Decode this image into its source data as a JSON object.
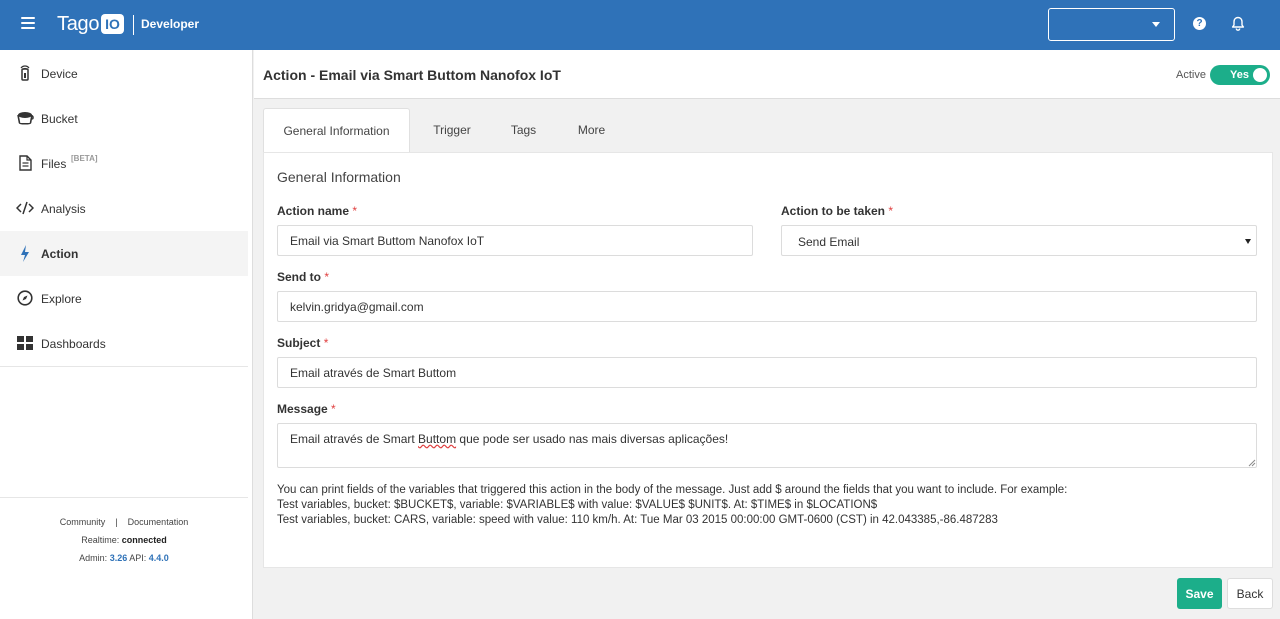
{
  "topbar": {
    "menu_icon": "hamburger-icon",
    "logo_text": "Tago",
    "logo_badge": "IO",
    "environment": "Developer",
    "select_value": "",
    "help_icon": "question-icon",
    "help_glyph": "?",
    "bell_icon": "bell-icon",
    "brand_color": "#2f72b8"
  },
  "sidebar": {
    "items": [
      {
        "label": "Device",
        "icon": "device-icon"
      },
      {
        "label": "Bucket",
        "icon": "bucket-icon"
      },
      {
        "label": "Files",
        "icon": "file-icon",
        "badge": "[BETA]"
      },
      {
        "label": "Analysis",
        "icon": "code-icon"
      },
      {
        "label": "Action",
        "icon": "bolt-icon",
        "active": true
      },
      {
        "label": "Explore",
        "icon": "compass-icon"
      },
      {
        "label": "Dashboards",
        "icon": "grid-icon"
      }
    ],
    "footer": {
      "community": "Community",
      "separator": "|",
      "documentation": "Documentation",
      "realtime_label": "Realtime:",
      "realtime_value": "connected",
      "admin_label": "Admin:",
      "admin_version": "3.26",
      "api_label": "API:",
      "api_version": "4.4.0"
    }
  },
  "header": {
    "title": "Action - Email via Smart Buttom Nanofox IoT",
    "active_label": "Active",
    "toggle_text": "Yes",
    "toggle_on": true,
    "accent_color": "#1cae8a"
  },
  "tabs": [
    {
      "label": "General Information",
      "active": true
    },
    {
      "label": "Trigger"
    },
    {
      "label": "Tags"
    },
    {
      "label": "More"
    }
  ],
  "form": {
    "section_title": "General Information",
    "required_mark": "*",
    "action_name": {
      "label": "Action name",
      "value": "Email via Smart Buttom Nanofox IoT"
    },
    "action_taken": {
      "label": "Action to be taken",
      "value": "Send Email"
    },
    "send_to": {
      "label": "Send to",
      "value": "kelvin.gridya@gmail.com"
    },
    "subject": {
      "label": "Subject",
      "value": "Email através de Smart Buttom"
    },
    "message": {
      "label": "Message",
      "value": "Email através de Smart Buttom que pode ser usado nas mais diversas aplicações!",
      "part1": "Email através de Smart ",
      "part2": "Buttom",
      "part3": " que pode ser usado nas mais diversas aplicações!"
    },
    "help_lines": [
      "You can print fields of the variables that triggered this action in the body of the message. Just add $ around the fields that you want to include. For example:",
      "Test variables, bucket: $BUCKET$, variable: $VARIABLE$ with value: $VALUE$ $UNIT$. At: $TIME$ in $LOCATION$",
      "Test variables, bucket: CARS, variable: speed with value: 110 km/h. At: Tue Mar 03 2015 00:00:00 GMT-0600 (CST) in 42.043385,-86.487283"
    ]
  },
  "buttons": {
    "save": "Save",
    "back": "Back"
  }
}
